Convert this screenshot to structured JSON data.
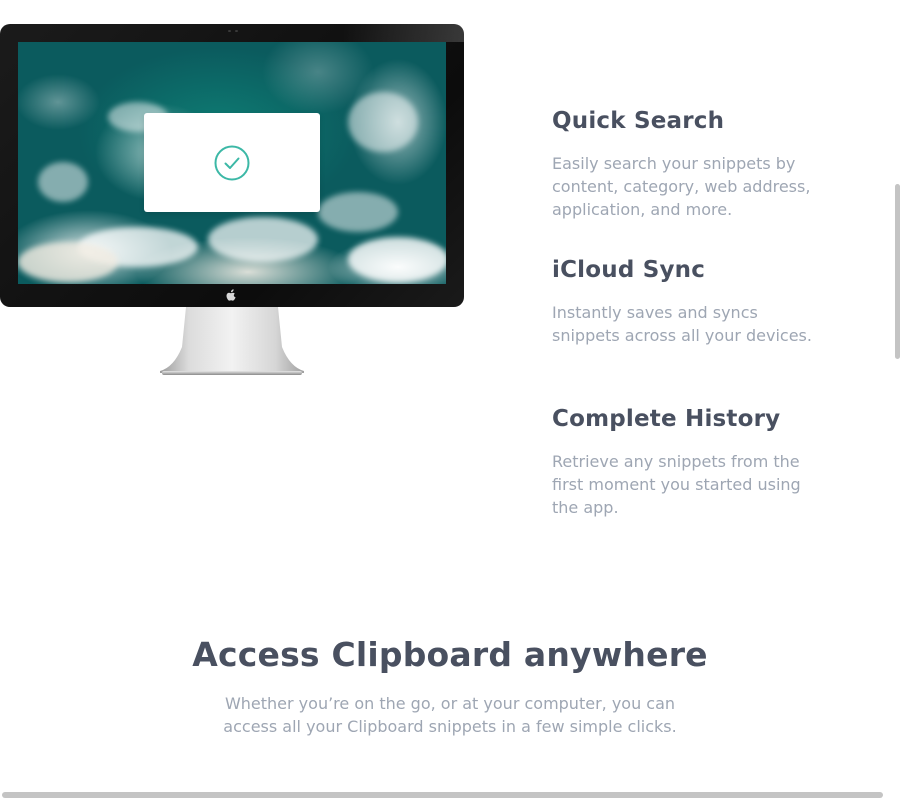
{
  "features": [
    {
      "title": "Quick Search",
      "description": "Easily search your snippets by content, category, web address, application, and more."
    },
    {
      "title": "iCloud Sync",
      "description": "Instantly saves and syncs snippets across all your devices."
    },
    {
      "title": "Complete History",
      "description": "Retrieve any snippets from the first moment you started using the app."
    }
  ],
  "access_section": {
    "title": "Access Clipboard anywhere",
    "description": "Whether you’re on the go, or at your computer, you can access all your Clipboard snippets in a few simple clicks."
  },
  "illustration": {
    "monitor": "imac-monitor",
    "wallpaper": "ocean-waves-aerial",
    "dialog_icon": "check-circle-icon",
    "logo_icon": "apple-logo-icon"
  },
  "colors": {
    "heading": "#495060",
    "body_text": "#9ea6b3",
    "accent": "#3cb8a6",
    "scrollbar": "#c4c4c4",
    "background": "#ffffff"
  }
}
